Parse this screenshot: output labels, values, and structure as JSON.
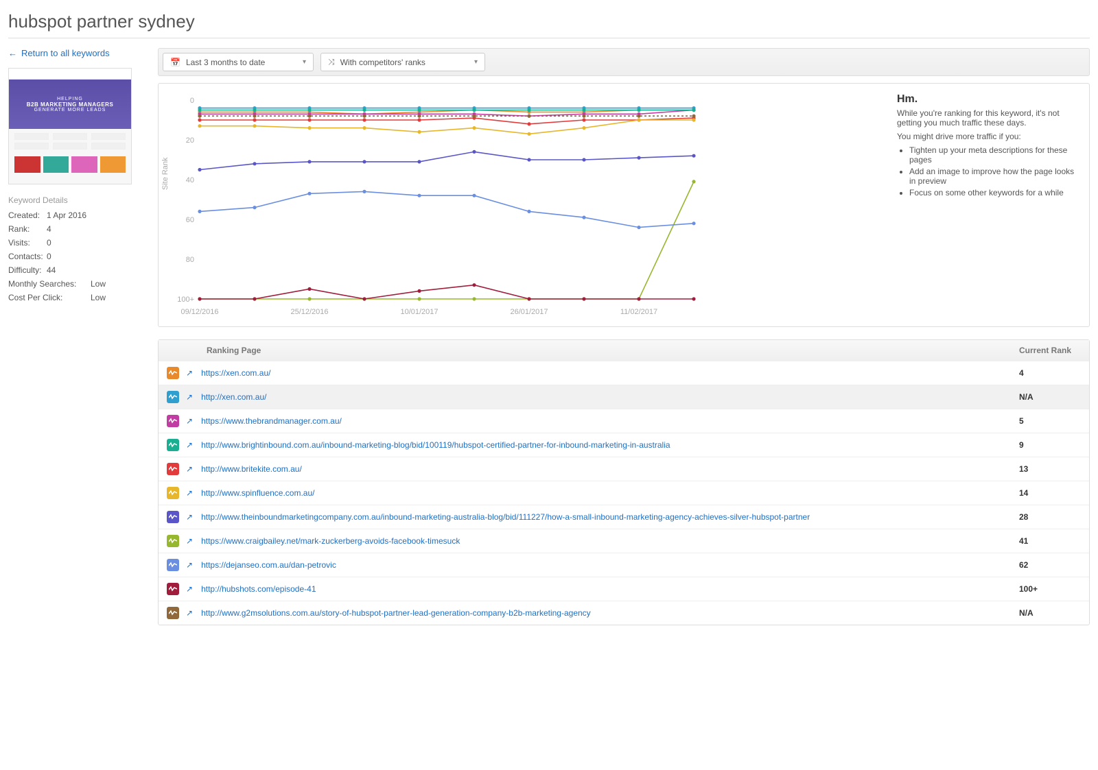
{
  "page_title": "hubspot partner sydney",
  "back_link_label": "Return to all keywords",
  "thumb": {
    "line1": "HELPING",
    "line2": "B2B MARKETING MANAGERS",
    "line3": "GENERATE MORE LEADS"
  },
  "keyword_details_heading": "Keyword Details",
  "keyword_details": [
    {
      "label": "Created:",
      "value": "1 Apr 2016",
      "long": false
    },
    {
      "label": "Rank:",
      "value": "4",
      "long": false
    },
    {
      "label": "Visits:",
      "value": "0",
      "long": false
    },
    {
      "label": "Contacts:",
      "value": "0",
      "long": false
    },
    {
      "label": "Difficulty:",
      "value": "44",
      "long": false
    },
    {
      "label": "Monthly Searches:",
      "value": "Low",
      "long": true
    },
    {
      "label": "Cost Per Click:",
      "value": "Low",
      "long": true
    }
  ],
  "toolbar": {
    "date_range": "Last 3 months to date",
    "mode": "With competitors' ranks"
  },
  "chart_data": {
    "type": "line",
    "ylabel": "Site Rank",
    "ylim": [
      0,
      100
    ],
    "y_ticks": [
      0,
      20,
      40,
      60,
      80,
      "100+"
    ],
    "x": [
      "09/12/2016",
      "",
      "25/12/2016",
      "",
      "10/01/2017",
      "",
      "26/01/2017",
      "",
      "11/02/2017",
      ""
    ],
    "x_tick_indices": [
      0,
      2,
      4,
      6,
      8
    ],
    "series": [
      {
        "name": "xen-https",
        "color": "#e88a2b",
        "values": [
          6,
          6,
          6,
          7,
          6,
          5,
          6,
          6,
          5,
          5
        ]
      },
      {
        "name": "xen-http",
        "color": "#2f9fcf",
        "values": [
          4,
          4,
          4,
          4,
          4,
          4,
          4,
          4,
          4,
          4
        ]
      },
      {
        "name": "brandmanager",
        "color": "#c23da3",
        "values": [
          7,
          7,
          7,
          7,
          7,
          7,
          8,
          7,
          7,
          5
        ]
      },
      {
        "name": "brightinbound",
        "color": "#1aaf92",
        "values": [
          5,
          5,
          5,
          5,
          5,
          5,
          5,
          5,
          5,
          5
        ]
      },
      {
        "name": "britekite",
        "color": "#e23b3b",
        "values": [
          10,
          10,
          10,
          10,
          10,
          9,
          12,
          10,
          10,
          9
        ]
      },
      {
        "name": "spinfluence",
        "color": "#e7b62a",
        "values": [
          13,
          13,
          14,
          14,
          16,
          14,
          17,
          14,
          10,
          10
        ]
      },
      {
        "name": "inboundcompany",
        "color": "#5a56c7",
        "values": [
          35,
          32,
          31,
          31,
          31,
          26,
          30,
          30,
          29,
          28
        ]
      },
      {
        "name": "craigbailey",
        "color": "#97b82e",
        "values": [
          100,
          100,
          100,
          100,
          100,
          100,
          100,
          100,
          100,
          41
        ]
      },
      {
        "name": "dejanseo",
        "color": "#6a8fe0",
        "values": [
          56,
          54,
          47,
          46,
          48,
          48,
          56,
          59,
          64,
          62
        ]
      },
      {
        "name": "hubshots",
        "color": "#a01d3c",
        "values": [
          100,
          100,
          95,
          100,
          96,
          93,
          100,
          100,
          100,
          100
        ]
      },
      {
        "name": "g2m",
        "color": "#91683a",
        "values": [
          8,
          8,
          8,
          8,
          8,
          8,
          8,
          8,
          8,
          8
        ],
        "dashed": true
      }
    ]
  },
  "info_panel": {
    "heading": "Hm.",
    "line1": "While you're ranking for this keyword, it's not getting you much traffic these days.",
    "line2": "You might drive more traffic if you:",
    "bullets": [
      "Tighten up your meta descriptions for these pages",
      "Add an image to improve how the page looks in preview",
      "Focus on some other keywords for a while"
    ]
  },
  "table": {
    "header_page": "Ranking Page",
    "header_rank": "Current Rank",
    "rows": [
      {
        "color": "#e88a2b",
        "url": "https://xen.com.au/",
        "rank": "4"
      },
      {
        "color": "#2f9fcf",
        "url": "http://xen.com.au/",
        "rank": "N/A"
      },
      {
        "color": "#c23da3",
        "url": "https://www.thebrandmanager.com.au/",
        "rank": "5"
      },
      {
        "color": "#1aaf92",
        "url": "http://www.brightinbound.com.au/inbound-marketing-blog/bid/100119/hubspot-certified-partner-for-inbound-marketing-in-australia",
        "rank": "9"
      },
      {
        "color": "#e23b3b",
        "url": "http://www.britekite.com.au/",
        "rank": "13"
      },
      {
        "color": "#e7b62a",
        "url": "http://www.spinfluence.com.au/",
        "rank": "14"
      },
      {
        "color": "#5a56c7",
        "url": "http://www.theinboundmarketingcompany.com.au/inbound-marketing-australia-blog/bid/111227/how-a-small-inbound-marketing-agency-achieves-silver-hubspot-partner",
        "rank": "28"
      },
      {
        "color": "#97b82e",
        "url": "https://www.craigbailey.net/mark-zuckerberg-avoids-facebook-timesuck",
        "rank": "41"
      },
      {
        "color": "#6a8fe0",
        "url": "https://dejanseo.com.au/dan-petrovic",
        "rank": "62"
      },
      {
        "color": "#a01d3c",
        "url": "http://hubshots.com/episode-41",
        "rank": "100+"
      },
      {
        "color": "#91683a",
        "url": "http://www.g2msolutions.com.au/story-of-hubspot-partner-lead-generation-company-b2b-marketing-agency",
        "rank": "N/A"
      }
    ]
  }
}
